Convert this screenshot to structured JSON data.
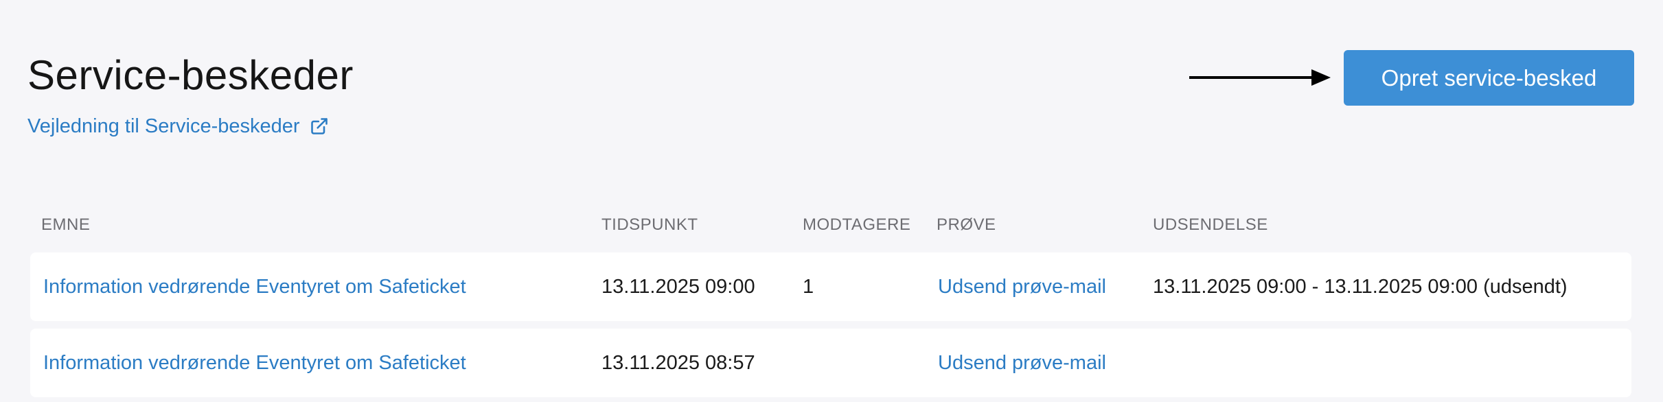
{
  "header": {
    "title": "Service-beskeder",
    "guide_link": "Vejledning til Service-beskeder",
    "create_button": "Opret service-besked"
  },
  "table": {
    "columns": [
      "EMNE",
      "TIDSPUNKT",
      "MODTAGERE",
      "PRØVE",
      "UDSENDELSE"
    ],
    "rows": [
      {
        "subject": "Information vedrørende Eventyret om Safeticket",
        "time": "13.11.2025 09:00",
        "recipients": "1",
        "test": "Udsend prøve-mail",
        "dispatch": "13.11.2025 09:00 - 13.11.2025 09:00 (udsendt)"
      },
      {
        "subject": "Information vedrørende Eventyret om Safeticket",
        "time": "13.11.2025 08:57",
        "recipients": "",
        "test": "Udsend prøve-mail",
        "dispatch": ""
      }
    ]
  },
  "colors": {
    "accent": "#3d8fd6",
    "link": "#2b7cc4",
    "background": "#f6f6f9"
  }
}
